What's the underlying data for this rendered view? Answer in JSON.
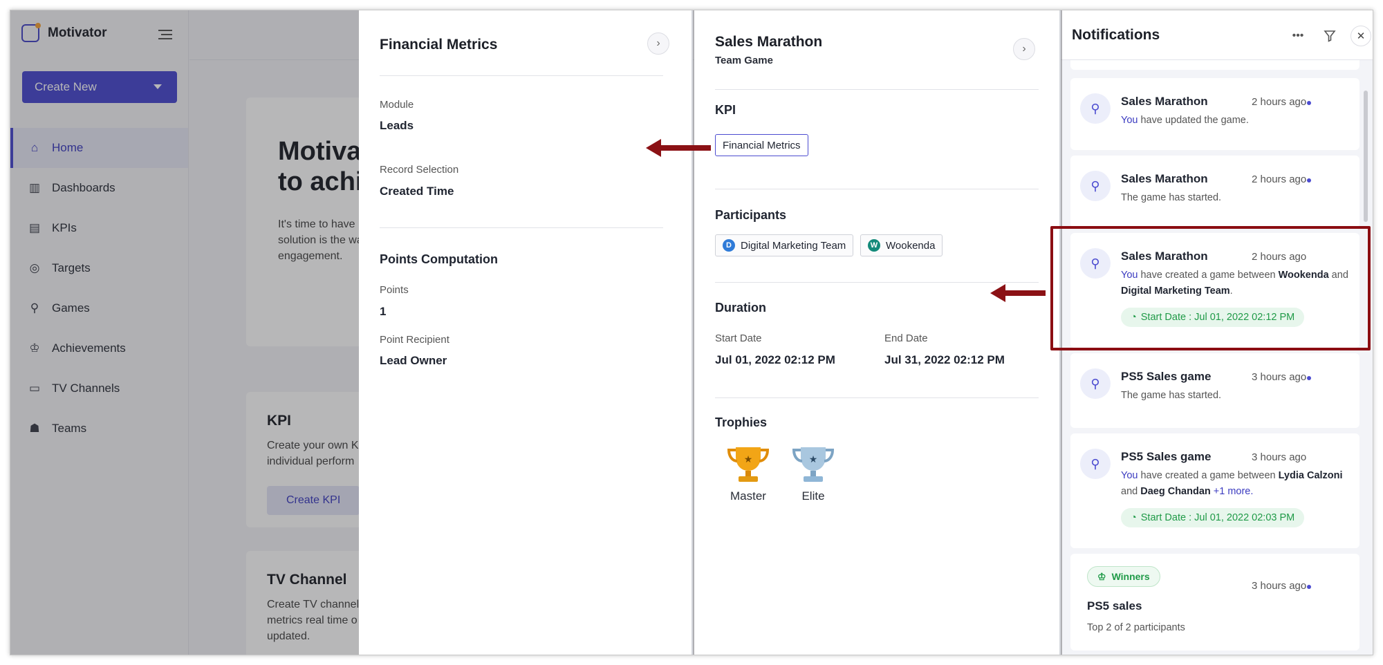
{
  "app": {
    "name": "Motivator"
  },
  "sidebar": {
    "create_new": "Create New",
    "items": [
      {
        "label": "Home",
        "icon": "home-icon"
      },
      {
        "label": "Dashboards",
        "icon": "dashboard-icon"
      },
      {
        "label": "KPIs",
        "icon": "clipboard-icon"
      },
      {
        "label": "Targets",
        "icon": "target-icon"
      },
      {
        "label": "Games",
        "icon": "joystick-icon"
      },
      {
        "label": "Achievements",
        "icon": "trophy-icon"
      },
      {
        "label": "TV Channels",
        "icon": "monitor-icon"
      },
      {
        "label": "Teams",
        "icon": "team-icon"
      }
    ]
  },
  "main": {
    "hero_title": "Motivat… to achie…",
    "hero_line1": "Motivat",
    "hero_line2": "to achie",
    "hero_text_1": "It's time to have",
    "hero_text_2": "solution is the wa",
    "hero_text_3": "engagement.",
    "kpi_title": "KPI",
    "kpi_text_1": "Create your own K",
    "kpi_text_2": "individual perform",
    "kpi_button": "Create KPI",
    "tv_title": "TV Channel",
    "tv_text_1": "Create TV channel",
    "tv_text_2": "metrics real time o",
    "tv_text_3": "updated."
  },
  "kpi_panel": {
    "title": "Financial Metrics",
    "module_label": "Module",
    "module_value": "Leads",
    "record_label": "Record Selection",
    "record_value": "Created Time",
    "points_section": "Points Computation",
    "points_label": "Points",
    "points_value": "1",
    "recipient_label": "Point Recipient",
    "recipient_value": "Lead Owner"
  },
  "game_panel": {
    "title": "Sales Marathon",
    "subtitle": "Team Game",
    "kpi_section": "KPI",
    "kpi_tag": "Financial Metrics",
    "participants_section": "Participants",
    "participants": [
      {
        "initial": "D",
        "name": "Digital Marketing Team",
        "color": "#2f7bd8"
      },
      {
        "initial": "W",
        "name": "Wookenda",
        "color": "#138a7a"
      }
    ],
    "duration_section": "Duration",
    "start_label": "Start Date",
    "start_value": "Jul 01, 2022 02:12 PM",
    "end_label": "End Date",
    "end_value": "Jul 31, 2022 02:12 PM",
    "trophies_section": "Trophies",
    "trophies": [
      {
        "name": "Master",
        "color": "#f2a516"
      },
      {
        "name": "Elite",
        "color": "#8fb6d6"
      }
    ]
  },
  "notifications": {
    "title": "Notifications",
    "items": [
      {
        "title": "Sales Marathon",
        "time": "2 hours ago",
        "you": "You",
        "text": " have updated the game."
      },
      {
        "title": "Sales Marathon",
        "time": "2 hours ago",
        "text": "The game has started."
      },
      {
        "title": "Sales Marathon",
        "time": "2 hours ago",
        "you": "You",
        "text_a": " have created a game between ",
        "b1": "Wookenda",
        "text_b": " and ",
        "b2": "Digital Marketing Team",
        "text_c": ".",
        "pill": "Start Date : Jul 01, 2022 02:12 PM"
      },
      {
        "title": "PS5 Sales game",
        "time": "3 hours ago",
        "text": "The game has started."
      },
      {
        "title": "PS5 Sales game",
        "time": "3 hours ago",
        "you": "You",
        "text_a": " have created a game between ",
        "b1": "Lydia Calzoni",
        "text_b": " and ",
        "b2": "Daeg Chandan",
        "more": " +1 more.",
        "pill": "Start Date : Jul 01, 2022 02:03 PM"
      },
      {
        "badge": "Winners",
        "title": "PS5 sales",
        "time": "3 hours ago",
        "text": "Top 2 of 2 participants"
      }
    ]
  },
  "colors": {
    "accent": "#4b4bd0",
    "highlight": "#8b0d12",
    "success": "#1f9a47"
  }
}
